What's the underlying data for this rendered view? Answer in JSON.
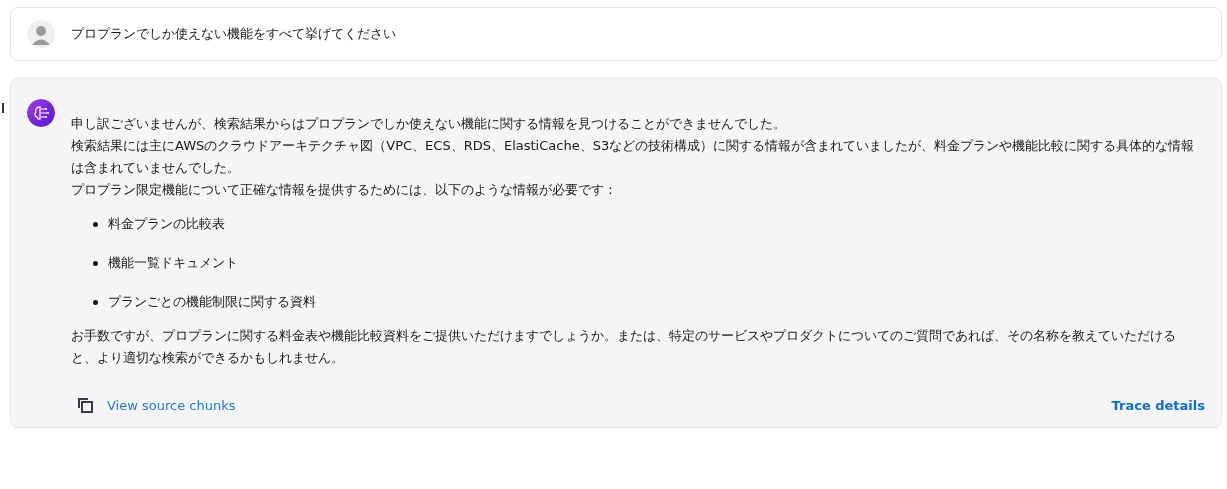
{
  "user_message": {
    "text": "プロプランでしか使えない機能をすべて挙げてください"
  },
  "assistant_message": {
    "paragraphs": [
      "申し訳ございませんが、検索結果からはプロプランでしか使えない機能に関する情報を見つけることができませんでした。",
      "検索結果には主にAWSのクラウドアーキテクチャ図（VPC、ECS、RDS、ElastiCache、S3などの技術構成）に関する情報が含まれていましたが、料金プランや機能比較に関する具体的な情報は含まれていませんでした。",
      "プロプラン限定機能について正確な情報を提供するためには、以下のような情報が必要です："
    ],
    "bullets": [
      "料金プランの比較表",
      "機能一覧ドキュメント",
      "プランごとの機能制限に関する資料"
    ],
    "closing": "お手数ですが、プロプランに関する料金表や機能比較資料をご提供いただけますでしょうか。または、特定のサービスやプロダクトについてのご質問であれば、その名称を教えていただけると、より適切な検索ができるかもしれません。"
  },
  "footer": {
    "source_link": "View source chunks",
    "trace_link": "Trace details"
  }
}
